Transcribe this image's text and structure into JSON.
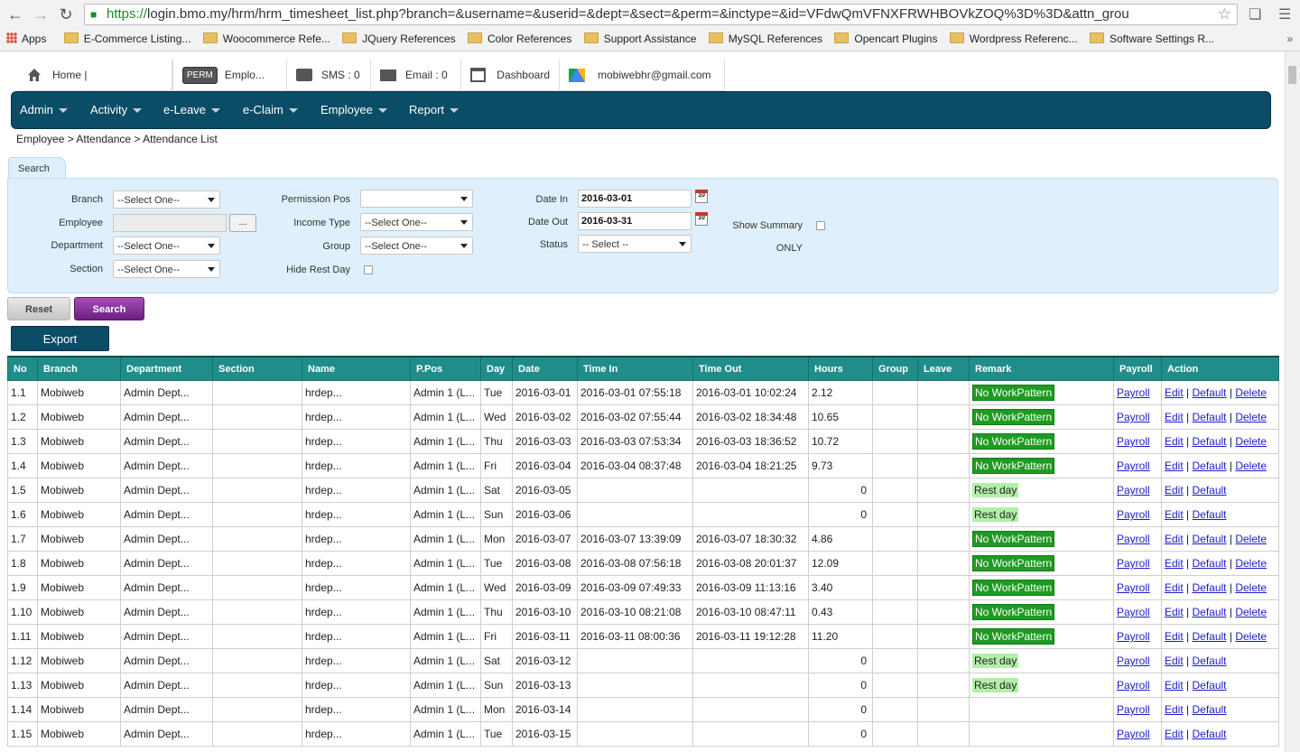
{
  "browser": {
    "url_scheme": "https://",
    "url_rest": "login.bmo.my/hrm/hrm_timesheet_list.php?branch=&username=&userid=&dept=&sect=&perm=&inctype=&id=VFdwQmVFNXFRWHBOVkZOQ%3D%3D&attn_grou",
    "bookmarks": [
      "Apps",
      "E-Commerce Listing...",
      "Woocommerce Refe...",
      "JQuery References",
      "Color References",
      "Support Assistance",
      "MySQL References",
      "Opencart Plugins",
      "Wordpress Referenc...",
      "Software Settings R..."
    ]
  },
  "topnav": {
    "home": "Home |",
    "perm_badge": "PERM",
    "employee": "Emplo...",
    "sms": "SMS : 0",
    "email": "Email : 0",
    "dashboard": "Dashboard",
    "account": "mobiwebhr@gmail.com"
  },
  "menu": [
    "Admin",
    "Activity",
    "e-Leave",
    "e-Claim",
    "Employee",
    "Report"
  ],
  "breadcrumb": "Employee > Attendance > Attendance List",
  "search": {
    "tab": "Search",
    "branch_label": "Branch",
    "branch_value": "--Select One--",
    "employee_label": "Employee",
    "employee_btn": "...",
    "department_label": "Department",
    "department_value": "--Select One--",
    "section_label": "Section",
    "section_value": "--Select One--",
    "permission_label": "Permission Pos",
    "permission_value": "",
    "income_label": "Income Type",
    "income_value": "--Select One--",
    "group_label": "Group",
    "group_value": "--Select One--",
    "hide_rest_label": "Hide Rest Day",
    "date_in_label": "Date In",
    "date_in_value": "2016-03-01",
    "date_out_label": "Date Out",
    "date_out_value": "2016-03-31",
    "status_label": "Status",
    "status_value": "-- Select --",
    "summary_label": "Show Summary",
    "only_label": "ONLY",
    "calendar_glyph": "10"
  },
  "buttons": {
    "reset": "Reset",
    "search": "Search",
    "export": "Export"
  },
  "table": {
    "headers": [
      "No",
      "Branch",
      "Department",
      "Section",
      "Name",
      "P.Pos",
      "Day",
      "Date",
      "Time In",
      "Time Out",
      "Hours",
      "Group",
      "Leave",
      "Remark",
      "Payroll",
      "Action"
    ],
    "action_labels": {
      "payroll": "Payroll",
      "edit": "Edit",
      "default": "Default",
      "delete": "Delete"
    },
    "rows": [
      {
        "no": "1.1",
        "branch": "Mobiweb",
        "dept": "Admin Dept...",
        "section": "",
        "name": "hrdep...",
        "ppos": "Admin 1 (L...",
        "day": "Tue",
        "date": "2016-03-01",
        "tin": "2016-03-01 07:55:18",
        "tout": "2016-03-01 10:02:24",
        "hours": "2.12",
        "remark": "No WorkPattern",
        "rtype": "nw",
        "del": true
      },
      {
        "no": "1.2",
        "branch": "Mobiweb",
        "dept": "Admin Dept...",
        "section": "",
        "name": "hrdep...",
        "ppos": "Admin 1 (L...",
        "day": "Wed",
        "date": "2016-03-02",
        "tin": "2016-03-02 07:55:44",
        "tout": "2016-03-02 18:34:48",
        "hours": "10.65",
        "remark": "No WorkPattern",
        "rtype": "nw",
        "del": true
      },
      {
        "no": "1.3",
        "branch": "Mobiweb",
        "dept": "Admin Dept...",
        "section": "",
        "name": "hrdep...",
        "ppos": "Admin 1 (L...",
        "day": "Thu",
        "date": "2016-03-03",
        "tin": "2016-03-03 07:53:34",
        "tout": "2016-03-03 18:36:52",
        "hours": "10.72",
        "remark": "No WorkPattern",
        "rtype": "nw",
        "del": true
      },
      {
        "no": "1.4",
        "branch": "Mobiweb",
        "dept": "Admin Dept...",
        "section": "",
        "name": "hrdep...",
        "ppos": "Admin 1 (L...",
        "day": "Fri",
        "date": "2016-03-04",
        "tin": "2016-03-04 08:37:48",
        "tout": "2016-03-04 18:21:25",
        "hours": "9.73",
        "remark": "No WorkPattern",
        "rtype": "nw",
        "del": true
      },
      {
        "no": "1.5",
        "branch": "Mobiweb",
        "dept": "Admin Dept...",
        "section": "",
        "name": "hrdep...",
        "ppos": "Admin 1 (L...",
        "day": "Sat",
        "date": "2016-03-05",
        "tin": "",
        "tout": "",
        "hours": "0",
        "remark": "Rest day",
        "rtype": "rest",
        "del": false
      },
      {
        "no": "1.6",
        "branch": "Mobiweb",
        "dept": "Admin Dept...",
        "section": "",
        "name": "hrdep...",
        "ppos": "Admin 1 (L...",
        "day": "Sun",
        "date": "2016-03-06",
        "tin": "",
        "tout": "",
        "hours": "0",
        "remark": "Rest day",
        "rtype": "rest",
        "del": false
      },
      {
        "no": "1.7",
        "branch": "Mobiweb",
        "dept": "Admin Dept...",
        "section": "",
        "name": "hrdep...",
        "ppos": "Admin 1 (L...",
        "day": "Mon",
        "date": "2016-03-07",
        "tin": "2016-03-07 13:39:09",
        "tout": "2016-03-07 18:30:32",
        "hours": "4.86",
        "remark": "No WorkPattern",
        "rtype": "nw",
        "del": true
      },
      {
        "no": "1.8",
        "branch": "Mobiweb",
        "dept": "Admin Dept...",
        "section": "",
        "name": "hrdep...",
        "ppos": "Admin 1 (L...",
        "day": "Tue",
        "date": "2016-03-08",
        "tin": "2016-03-08 07:56:18",
        "tout": "2016-03-08 20:01:37",
        "hours": "12.09",
        "remark": "No WorkPattern",
        "rtype": "nw",
        "del": true
      },
      {
        "no": "1.9",
        "branch": "Mobiweb",
        "dept": "Admin Dept...",
        "section": "",
        "name": "hrdep...",
        "ppos": "Admin 1 (L...",
        "day": "Wed",
        "date": "2016-03-09",
        "tin": "2016-03-09 07:49:33",
        "tout": "2016-03-09 11:13:16",
        "hours": "3.40",
        "remark": "No WorkPattern",
        "rtype": "nw",
        "del": true
      },
      {
        "no": "1.10",
        "branch": "Mobiweb",
        "dept": "Admin Dept...",
        "section": "",
        "name": "hrdep...",
        "ppos": "Admin 1 (L...",
        "day": "Thu",
        "date": "2016-03-10",
        "tin": "2016-03-10 08:21:08",
        "tout": "2016-03-10 08:47:11",
        "hours": "0.43",
        "remark": "No WorkPattern",
        "rtype": "nw",
        "del": true
      },
      {
        "no": "1.11",
        "branch": "Mobiweb",
        "dept": "Admin Dept...",
        "section": "",
        "name": "hrdep...",
        "ppos": "Admin 1 (L...",
        "day": "Fri",
        "date": "2016-03-11",
        "tin": "2016-03-11 08:00:36",
        "tout": "2016-03-11 19:12:28",
        "hours": "11.20",
        "remark": "No WorkPattern",
        "rtype": "nw",
        "del": true
      },
      {
        "no": "1.12",
        "branch": "Mobiweb",
        "dept": "Admin Dept...",
        "section": "",
        "name": "hrdep...",
        "ppos": "Admin 1 (L...",
        "day": "Sat",
        "date": "2016-03-12",
        "tin": "",
        "tout": "",
        "hours": "0",
        "remark": "Rest day",
        "rtype": "rest",
        "del": false
      },
      {
        "no": "1.13",
        "branch": "Mobiweb",
        "dept": "Admin Dept...",
        "section": "",
        "name": "hrdep...",
        "ppos": "Admin 1 (L...",
        "day": "Sun",
        "date": "2016-03-13",
        "tin": "",
        "tout": "",
        "hours": "0",
        "remark": "Rest day",
        "rtype": "rest",
        "del": false
      },
      {
        "no": "1.14",
        "branch": "Mobiweb",
        "dept": "Admin Dept...",
        "section": "",
        "name": "hrdep...",
        "ppos": "Admin 1 (L...",
        "day": "Mon",
        "date": "2016-03-14",
        "tin": "",
        "tout": "",
        "hours": "0",
        "remark": "",
        "rtype": "",
        "del": false
      },
      {
        "no": "1.15",
        "branch": "Mobiweb",
        "dept": "Admin Dept...",
        "section": "",
        "name": "hrdep...",
        "ppos": "Admin 1 (L...",
        "day": "Tue",
        "date": "2016-03-15",
        "tin": "",
        "tout": "",
        "hours": "0",
        "remark": "",
        "rtype": "",
        "del": false
      }
    ]
  },
  "colors": {
    "menu_bg": "#0b4c66",
    "table_header": "#208d8b",
    "no_workpattern": "#1f9a22",
    "rest_day": "#b2f0a8",
    "search_btn": "#8a3a9c"
  }
}
